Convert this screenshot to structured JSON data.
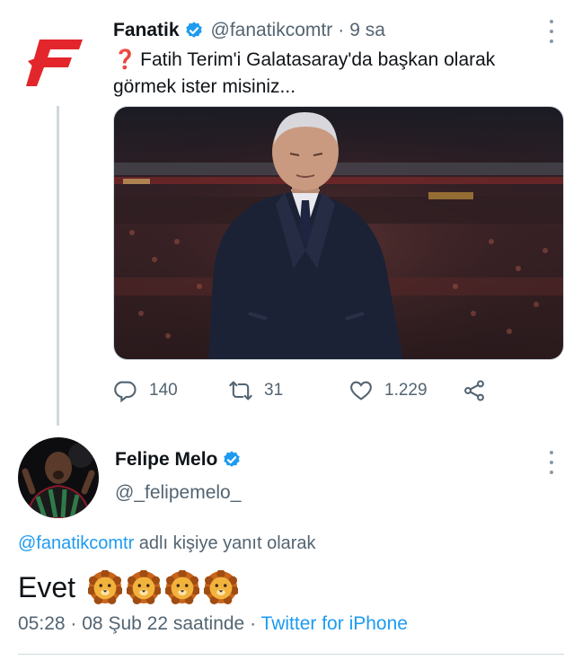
{
  "parent_tweet": {
    "author_name": "Fanatik",
    "handle": "@fanatikcomtr",
    "separator": "·",
    "time": "9 sa",
    "text": "Fatih Terim'i Galatasaray'da başkan olarak görmek ister misiniz...",
    "text_icon": "red-question-mark-emoji",
    "avatar": "fanatik-logo",
    "media": "photo-man-in-navy-coat-stadium",
    "actions": {
      "replies": "140",
      "retweets": "31",
      "likes": "1.229"
    }
  },
  "reply_tweet": {
    "author_name": "Felipe Melo",
    "handle": "@_felipemelo_",
    "reply_mention": "@fanatikcomtr",
    "reply_suffix": "adlı kişiye yanıt olarak",
    "text": "Evet",
    "emoji": [
      "lion-face",
      "lion-face",
      "lion-face",
      "lion-face"
    ],
    "time": "05:28",
    "separator": "·",
    "date": "08 Şub 22 saatinde",
    "separator2": "·",
    "source": "Twitter for iPhone"
  },
  "colors": {
    "accent": "#1d9bf0",
    "secondary_text": "#536471",
    "fanatik_red": "#e3262b",
    "thread_line": "#cfd9de"
  }
}
